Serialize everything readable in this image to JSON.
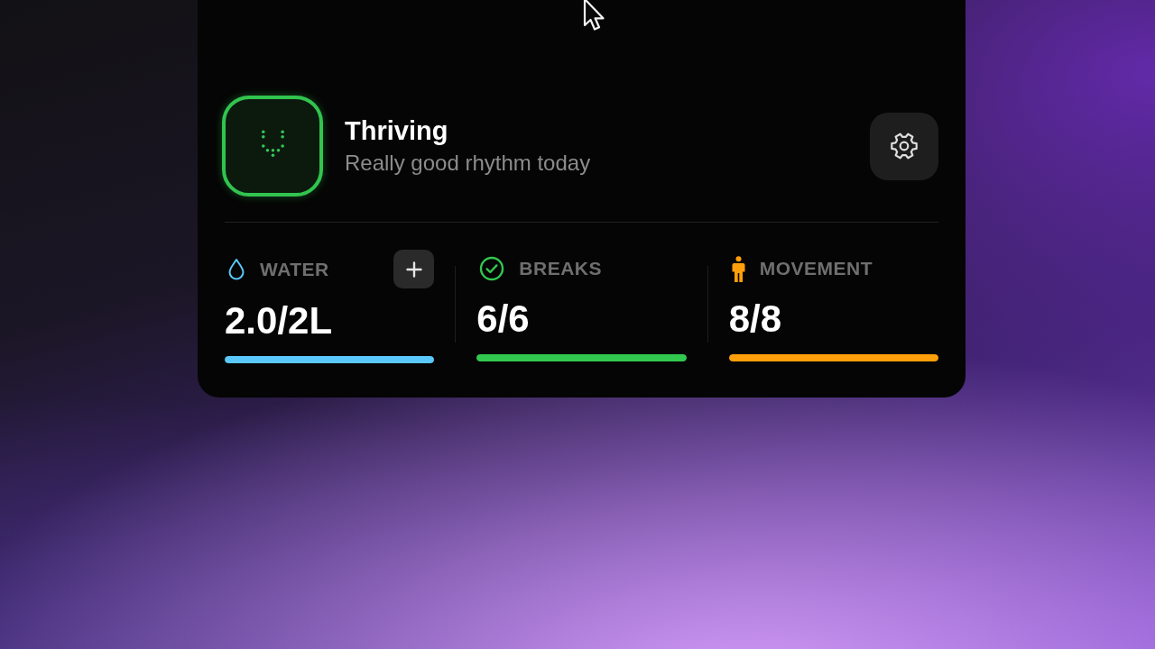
{
  "status": {
    "title": "Thriving",
    "subtitle": "Really good rhythm today"
  },
  "stats": [
    {
      "kind": "water",
      "label": "WATER",
      "value": "2.0/2L",
      "level": 1,
      "color": "#5ac8fa",
      "add_button": true
    },
    {
      "kind": "breaks",
      "label": "BREAKS",
      "value": "6/6",
      "level": 1,
      "color": "#32c84f",
      "add_button": false
    },
    {
      "kind": "movement",
      "label": "MOVEMENT",
      "value": "8/8",
      "level": 1,
      "color": "#ff9f0a",
      "add_button": false
    }
  ]
}
